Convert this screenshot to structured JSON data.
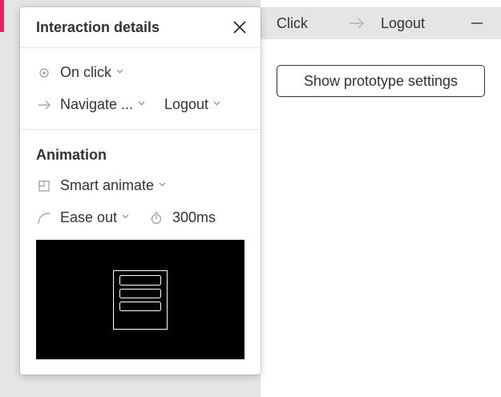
{
  "popup": {
    "title": "Interaction details",
    "trigger": {
      "label": "On click",
      "icon": "click-trigger-icon"
    },
    "action": {
      "label": "Navigate ...",
      "icon": "arrow-right-icon"
    },
    "destination": {
      "label": "Logout"
    },
    "animation_section": {
      "title": "Animation",
      "type": {
        "label": "Smart animate",
        "icon": "smart-animate-icon"
      },
      "easing": {
        "label": "Ease out",
        "icon": "easing-curve-icon"
      },
      "duration": {
        "label": "300ms",
        "icon": "timer-icon"
      }
    },
    "preview_icon": "menu-frame-preview-icon"
  },
  "right_panel": {
    "trigger": "Click",
    "target": "Logout",
    "prototype_button": "Show prototype settings"
  },
  "colors": {
    "canvas": "#e5e5e5",
    "accent": "#e5245f",
    "text": "#333333",
    "preview_bg": "#000000"
  }
}
